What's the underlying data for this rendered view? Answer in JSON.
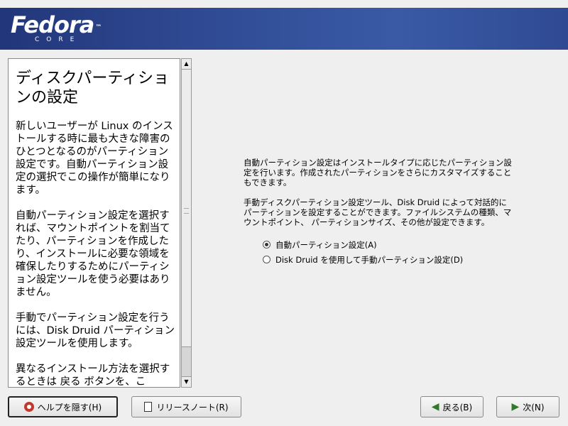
{
  "banner": {
    "logo_text": "Fedora",
    "logo_tm": "™",
    "logo_sub": "CORE"
  },
  "help": {
    "title": "ディスクパーティションの設定",
    "paragraphs": [
      "新しいユーザーが Linux のインストールする時に最も大きな障害のひとつとなるのがパーティション設定です。自動パーティション設定の選択でこの操作が簡単になります。",
      "自動パーティション設定を選択すれば、マウントポイントを割当てたり、パーティションを作成したり、インストールに必要な領域を確保したりするためにパーティション設定ツールを使う必要はありません。",
      "手動でパーティション設定を行うには、Disk Druid パーティション設定ツールを使用します。",
      "異なるインストール方法を選択するときは 戻る ボタンを、こ"
    ]
  },
  "main": {
    "intro1": "自動パーティション設定はインストールタイプに応じたパーティション設定を行います。作成されたパーティションをさらにカスタマイズすることもできます。",
    "intro2": "手動ディスクパーティション設定ツール、Disk Druid によって対話的にパーティションを設定することができます。ファイルシステムの種類、マウントポイント、 パーティションサイズ、その他が設定できます。",
    "options": [
      {
        "label": "自動パーティション設定(A)",
        "selected": true
      },
      {
        "label": "Disk Druid を使用して手動パーティション設定(D)",
        "selected": false
      }
    ]
  },
  "buttons": {
    "help": "ヘルプを隠す(H)",
    "release_notes": "リリースノート(R)",
    "back": "戻る(B)",
    "next": "次(N)"
  },
  "colors": {
    "banner": "#2f4a93",
    "arrow": "#2f7a2a",
    "help_icon": "#c0392b"
  },
  "icons": [
    "lifebuoy-icon",
    "document-icon",
    "arrow-left-icon",
    "arrow-right-icon"
  ]
}
